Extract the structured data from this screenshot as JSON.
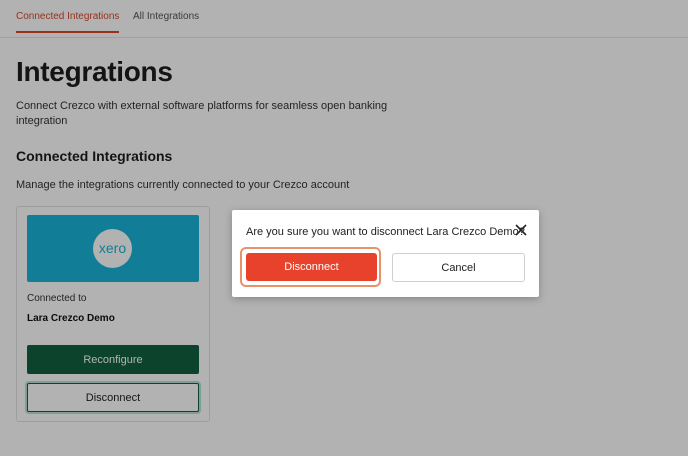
{
  "tabs": [
    {
      "label": "Connected Integrations",
      "active": true
    },
    {
      "label": "All Integrations",
      "active": false
    }
  ],
  "page": {
    "title": "Integrations",
    "description": "Connect Crezco with external software platforms for seamless open banking integration",
    "section_title": "Connected Integrations",
    "section_description": "Manage the integrations currently connected to your Crezco account"
  },
  "card": {
    "logo_text": "xero",
    "logo_color": "#1ab4d7",
    "connected_to_label": "Connected to",
    "organization": "Lara Crezco Demo",
    "reconfigure_label": "Reconfigure",
    "disconnect_label": "Disconnect"
  },
  "modal": {
    "message": "Are you sure you want to disconnect Lara Crezco Demo?",
    "disconnect_label": "Disconnect",
    "cancel_label": "Cancel",
    "close_icon": "close-icon"
  },
  "colors": {
    "accent": "#d9472b",
    "primary_green": "#10603f",
    "danger": "#e8422c"
  }
}
